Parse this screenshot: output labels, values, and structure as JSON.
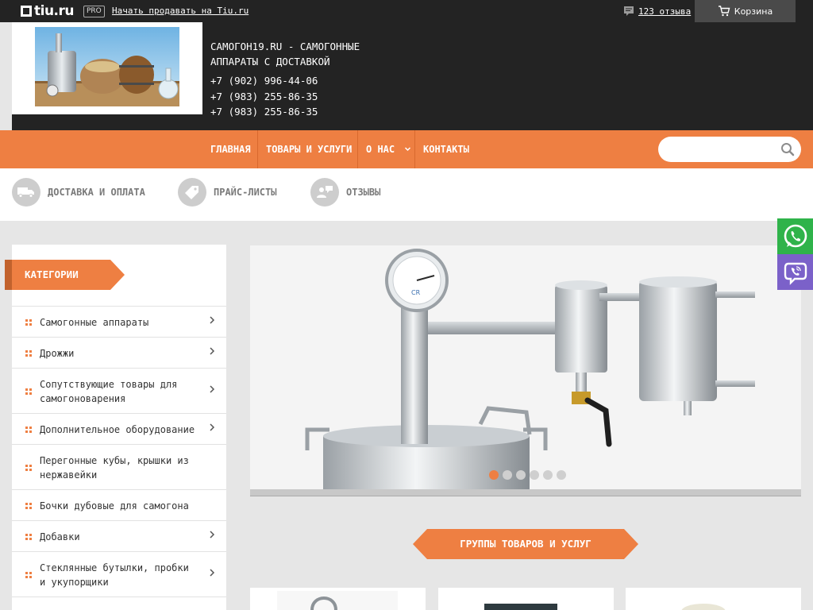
{
  "topbar": {
    "logo_text": "tiu.ru",
    "pro_badge": "PRO",
    "sell_link": "Начать продавать на Tiu.ru",
    "reviews_link": "123 отзыва",
    "cart_label": "Корзина"
  },
  "header": {
    "site_title": "САМОГОН19.RU - САМОГОННЫЕ АППАРАТЫ С ДОСТАВКОЙ",
    "phones": [
      "+7 (902) 996-44-06",
      "+7 (983) 255-86-35",
      "+7 (983) 255-86-35"
    ]
  },
  "nav": {
    "items": [
      {
        "label": "Главная"
      },
      {
        "label": "Товары и услуги"
      },
      {
        "label": "О нас"
      },
      {
        "label": "Контакты"
      }
    ],
    "search_placeholder": ""
  },
  "strip": {
    "items": [
      {
        "label": "Доставка и оплата",
        "icon": "truck-icon"
      },
      {
        "label": "Прайс-листы",
        "icon": "tag-icon"
      },
      {
        "label": "Отзывы",
        "icon": "reviews-icon"
      }
    ]
  },
  "sidebar": {
    "heading": "Категории",
    "categories": [
      {
        "label": "Самогонные аппараты",
        "has_arrow": true
      },
      {
        "label": "Дрожжи",
        "has_arrow": true
      },
      {
        "label": "Сопутствующие товары для самогоноварения",
        "has_arrow": true
      },
      {
        "label": "Дополнительное оборудование",
        "has_arrow": true
      },
      {
        "label": "Перегонные кубы, крышки из нержавейки",
        "has_arrow": false
      },
      {
        "label": "Бочки дубовые для самогона",
        "has_arrow": false
      },
      {
        "label": "Добавки",
        "has_arrow": true
      },
      {
        "label": "Стеклянные бутылки, пробки и укупорщики",
        "has_arrow": true
      }
    ]
  },
  "slider": {
    "slide_count": 6,
    "active_index": 0
  },
  "main": {
    "groups_heading": "Группы товаров и услуг"
  },
  "colors": {
    "accent": "#ee7f42",
    "dark": "#232323",
    "whatsapp": "#2fb34a",
    "viber": "#7b61c9"
  }
}
